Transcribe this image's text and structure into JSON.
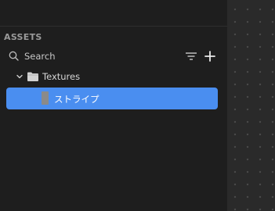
{
  "assets_panel": {
    "title": "ASSETS",
    "search": {
      "placeholder": "Search",
      "value": ""
    },
    "filter_icon": "filter-icon",
    "add_icon": "plus-icon",
    "tree": [
      {
        "type": "folder",
        "label": "Textures",
        "expanded": true,
        "icon": "folder-icon",
        "children": [
          {
            "type": "asset",
            "label": "ストライプ",
            "selected": true,
            "icon": "texture-thumbnail-icon"
          }
        ]
      }
    ]
  },
  "colors": {
    "panel_background": "#1e1e1e",
    "selection": "#4a8ef0",
    "canvas_background": "#2a2a2a"
  }
}
